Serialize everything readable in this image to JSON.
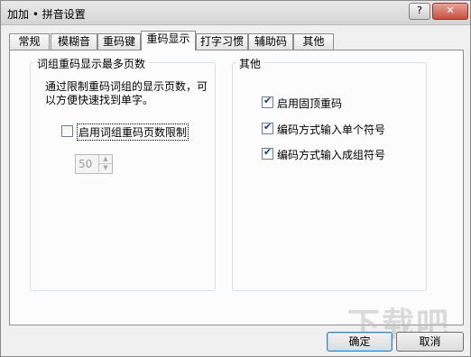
{
  "window": {
    "title": "加加 • 拼音设置",
    "help_glyph": "?",
    "close_glyph": "✕"
  },
  "tabs": [
    {
      "label": "常规"
    },
    {
      "label": "模糊音"
    },
    {
      "label": "重码键"
    },
    {
      "label": "重码显示"
    },
    {
      "label": "打字习惯"
    },
    {
      "label": "辅助码"
    },
    {
      "label": "其他"
    }
  ],
  "active_tab": "重码显示",
  "left_group": {
    "title": "词组重码显示最多页数",
    "description": "通过限制重码词组的显示页数，可以方便快速找到单字。",
    "enable_limit_label": "启用词组重码页数限制",
    "enable_limit_checked": false,
    "page_limit_value": "50"
  },
  "right_group": {
    "title": "其他",
    "options": [
      {
        "label": "启用固顶重码",
        "checked": true
      },
      {
        "label": "编码方式输入单个符号",
        "checked": true
      },
      {
        "label": "编码方式输入成组符号",
        "checked": true
      }
    ]
  },
  "buttons": {
    "ok": "确定",
    "cancel": "取消"
  },
  "watermark": "下载吧"
}
